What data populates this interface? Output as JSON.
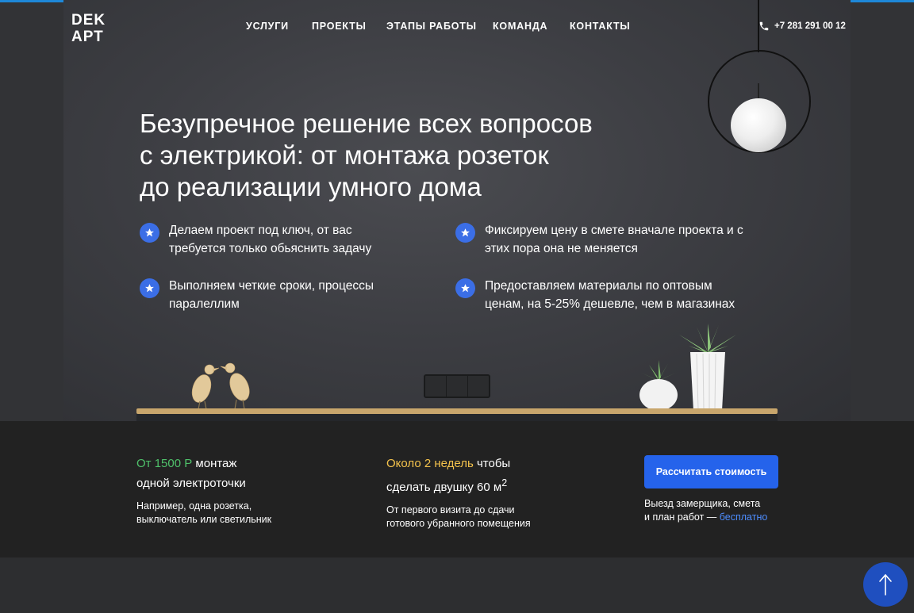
{
  "header": {
    "logo": {
      "line1": "DEK",
      "line2": "АРТ"
    },
    "nav": [
      "УСЛУГИ",
      "ПРОЕКТЫ",
      "ЭТАПЫ РАБОТЫ",
      "КОМАНДА",
      "КОНТАКТЫ"
    ],
    "phone": "+7 281 291 00 12",
    "phone_icon": "phone-icon"
  },
  "hero": {
    "headline": [
      "Безупречное решение всех вопросов",
      "с электрикой: от монтажа розеток",
      "до реализации умного дома"
    ],
    "features": [
      {
        "icon": "star-icon",
        "lines": [
          "Делаем проект под ключ, от вас",
          "требуется только обьяснить задачу"
        ]
      },
      {
        "icon": "star-icon",
        "lines": [
          "Фиксируем цену в смете вначале проекта и с",
          "этих пора она не меняется"
        ]
      },
      {
        "icon": "star-icon",
        "lines": [
          "Выполняем четкие сроки, процессы",
          "паралеллим"
        ]
      },
      {
        "icon": "star-icon",
        "lines": [
          "Предоставляем материалы по оптовым",
          "ценам, на 5-25% дешевле, чем в магазинах"
        ]
      }
    ]
  },
  "info_band": {
    "price": {
      "highlight": "От 1500 Р",
      "rest": " монтаж",
      "line2": "одной электроточки",
      "sub": [
        "Например, одна розетка,",
        "выключатель или светильник"
      ],
      "accent_color": "#4fc06a"
    },
    "time": {
      "highlight": "Около 2 недель",
      "rest": " чтобы",
      "line2": "сделать двушку 60 м",
      "sup": "2",
      "sub": [
        "От первого визита до сдачи",
        "готового убранного помещения"
      ],
      "accent_color": "#f3c24c"
    },
    "cta": {
      "button": "Рассчитать стоимость",
      "note_line1": "Выезд замерщика, смета",
      "note_line2": "и план работ — ",
      "note_link": "бесплатно",
      "button_color": "#2563eb"
    }
  },
  "scroll_top_icon": "arrow-up-icon",
  "colors": {
    "accent_blue": "#3b6ee6",
    "band_bg": "#222222",
    "top_line": "#1e88d8"
  }
}
